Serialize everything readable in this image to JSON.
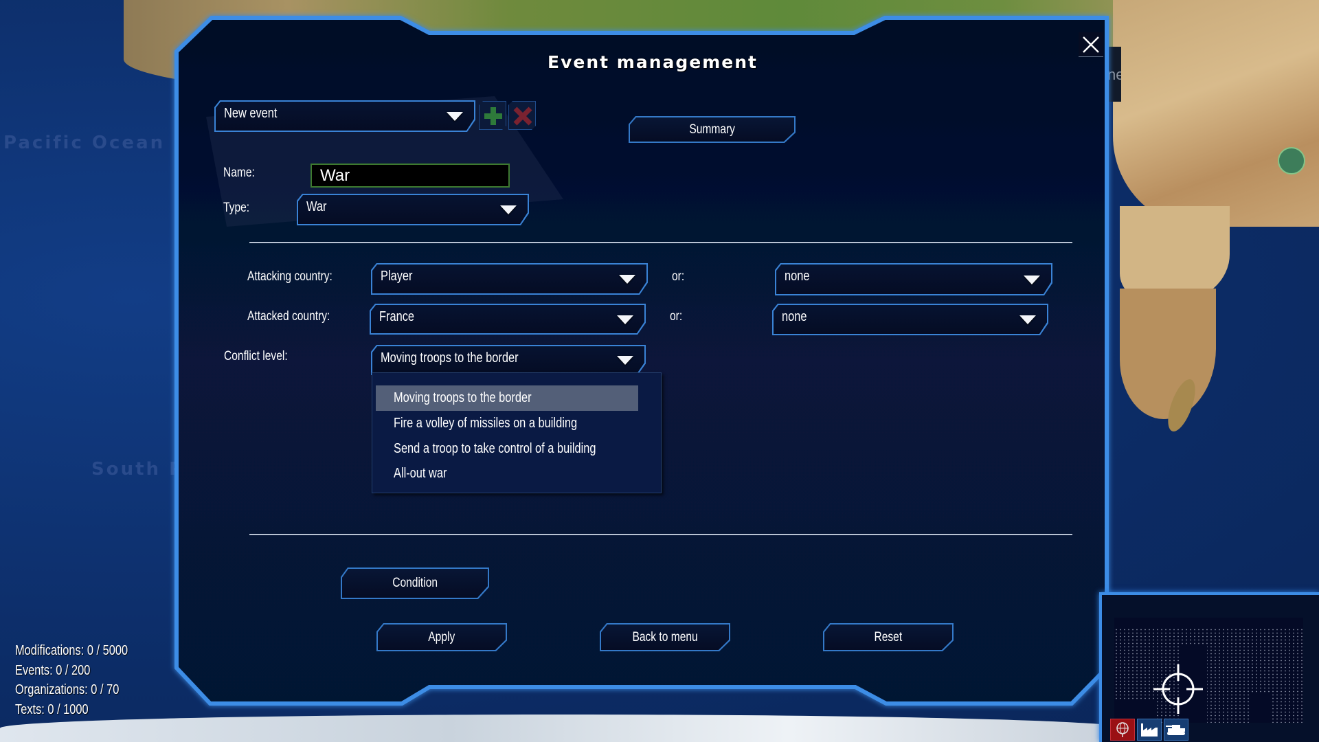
{
  "window": {
    "title": "Event management",
    "close_icon": "close-icon"
  },
  "map": {
    "ocean_labels": [
      "Pacific Ocean",
      "South P"
    ],
    "hidden_tab_text": "ne"
  },
  "event_selector": {
    "value": "New event",
    "add_icon": "plus-icon",
    "delete_icon": "x-icon"
  },
  "summary_button": {
    "label": "Summary"
  },
  "name": {
    "label": "Name:",
    "value": "War"
  },
  "type": {
    "label": "Type:",
    "value": "War"
  },
  "attacking": {
    "label": "Attacking country:",
    "value": "Player",
    "or_label": "or:",
    "or_value": "none"
  },
  "attacked": {
    "label": "Attacked country:",
    "value": "France",
    "or_label": "or:",
    "or_value": "none"
  },
  "conflict": {
    "label": "Conflict level:",
    "value": "Moving troops to the border",
    "options": [
      "Moving troops to the border",
      "Fire a volley of missiles on a building",
      "Send a troop to take control of a building",
      "All-out war"
    ],
    "selected_index": 0
  },
  "buttons": {
    "condition": "Condition",
    "apply": "Apply",
    "back": "Back to menu",
    "reset": "Reset"
  },
  "stats": [
    "Modifications: 0 /  5000",
    "Events: 0 /  200",
    "Organizations: 0 /  70",
    "Texts: 0 /  1000"
  ],
  "minimap": {
    "buttons": [
      {
        "icon": "globe-icon",
        "active": true
      },
      {
        "icon": "factory-icon",
        "active": false
      },
      {
        "icon": "tank-icon",
        "active": false
      }
    ]
  },
  "colors": {
    "panel_bg": "#061130",
    "panel_border": "#3d8de6",
    "selected_item": "#535f78",
    "add_green": "#2e7a3a",
    "delete_red": "#7a2230"
  }
}
